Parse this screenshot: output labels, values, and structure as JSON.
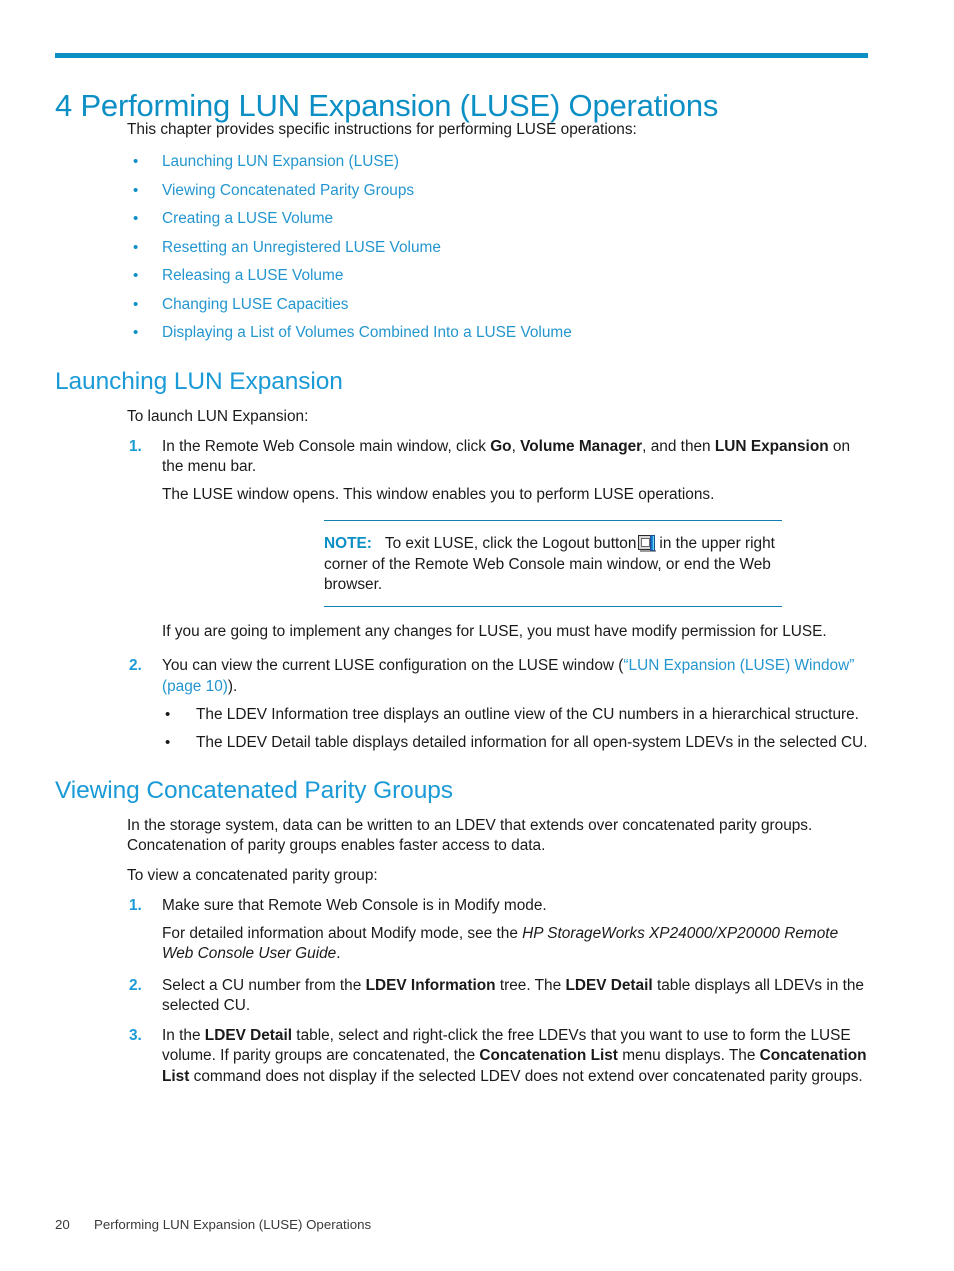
{
  "colors": {
    "accent_blue": "#0b8fc4",
    "heading_blue": "#1a9ad6",
    "link_blue": "#2496cf",
    "body_text": "#1a1a1a"
  },
  "chapter": {
    "title": "4 Performing LUN Expansion (LUSE) Operations",
    "intro": "This chapter provides specific instructions for performing LUSE operations:"
  },
  "toc": {
    "bullet_glyph": "•",
    "items": [
      {
        "label": "Launching LUN Expansion (LUSE)"
      },
      {
        "label": "Viewing Concatenated Parity Groups"
      },
      {
        "label": "Creating a LUSE Volume"
      },
      {
        "label": "Resetting an Unregistered LUSE Volume"
      },
      {
        "label": "Releasing a LUSE Volume"
      },
      {
        "label": "Changing LUSE Capacities"
      },
      {
        "label": "Displaying a List of Volumes Combined Into a LUSE Volume"
      }
    ]
  },
  "section_launching": {
    "heading": "Launching LUN Expansion",
    "lead": "To launch LUN Expansion:",
    "step1": {
      "num": "1.",
      "text_a": "In the Remote Web Console main window, click ",
      "bold_go": "Go",
      "text_b": ", ",
      "bold_vm": "Volume Manager",
      "text_c": ", and then ",
      "bold_lun": "LUN Expansion",
      "text_d": " on the menu bar.",
      "followup": "The LUSE window opens. This window enables you to perform LUSE operations."
    },
    "note": {
      "label": "NOTE:",
      "text_a": "To exit LUSE, click the Logout button",
      "icon": "logout-button-icon",
      "text_b": "in the upper right corner of the Remote Web Console main window, or end the Web browser."
    },
    "after_note": "If you are going to implement any changes for LUSE, you must have modify permission for LUSE.",
    "step2": {
      "num": "2.",
      "text_a": "You can view the current LUSE configuration on the LUSE window (",
      "link": "“LUN Expansion (LUSE) Window” (page 10)",
      "text_b": ").",
      "bullets": [
        "The LDEV Information tree displays an outline view of the CU numbers in a hierarchical structure.",
        "The LDEV Detail table displays detailed information for all open-system LDEVs in the selected CU."
      ]
    }
  },
  "section_viewing": {
    "heading": "Viewing Concatenated Parity Groups",
    "para1": "In the storage system, data can be written to an LDEV that extends over concatenated parity groups. Concatenation of parity groups enables faster access to data.",
    "para2": "To view a concatenated parity group:",
    "step1": {
      "num": "1.",
      "text": "Make sure that Remote Web Console is in Modify mode.",
      "followup_a": "For detailed information about Modify mode, see the ",
      "followup_italic": "HP StorageWorks XP24000/XP20000 Remote Web Console User Guide",
      "followup_b": "."
    },
    "step2": {
      "num": "2.",
      "text_a": "Select a CU number from the ",
      "bold_a": "LDEV Information",
      "text_b": " tree. The ",
      "bold_b": "LDEV Detail",
      "text_c": " table displays all LDEVs in the selected CU."
    },
    "step3": {
      "num": "3.",
      "text_a": "In the ",
      "bold_a": "LDEV Detail",
      "text_b": " table, select and right-click the free LDEVs that you want to use to form the LUSE volume. If parity groups are concatenated, the ",
      "bold_b": "Concatenation List",
      "text_c": " menu displays. The ",
      "bold_c": "Concatenation List",
      "text_d": " command does not display if the selected LDEV does not extend over concatenated parity groups."
    }
  },
  "footer": {
    "page_number": "20",
    "running_title": "Performing LUN Expansion (LUSE) Operations"
  }
}
